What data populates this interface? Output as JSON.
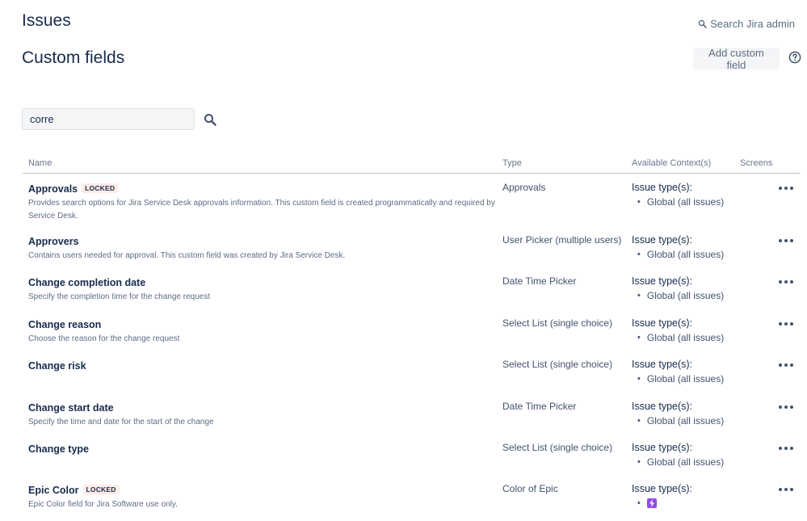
{
  "header": {
    "section_title": "Issues",
    "search_admin_label": "Search Jira admin",
    "page_title": "Custom fields",
    "add_button_label": "Add custom field"
  },
  "filter": {
    "value": "corre"
  },
  "table": {
    "columns": [
      "Name",
      "Type",
      "Available Context(s)",
      "Screens"
    ],
    "rows": [
      {
        "name": "Approvals",
        "lozenge": "LOCKED",
        "description": "Provides search options for Jira Service Desk approvals information. This custom field is created programmatically and required by Service Desk.",
        "type": "Approvals",
        "context_label": "Issue type(s):",
        "context_value": "Global (all issues)"
      },
      {
        "name": "Approvers",
        "description": "Contains users needed for approval. This custom field was created by Jira Service Desk.",
        "type": "User Picker (multiple users)",
        "context_label": "Issue type(s):",
        "context_value": "Global (all issues)"
      },
      {
        "name": "Change completion date",
        "description": "Specify the completion time for the change request",
        "type": "Date Time Picker",
        "context_label": "Issue type(s):",
        "context_value": "Global (all issues)"
      },
      {
        "name": "Change reason",
        "description": "Choose the reason for the change request",
        "type": "Select List (single choice)",
        "context_label": "Issue type(s):",
        "context_value": "Global (all issues)"
      },
      {
        "name": "Change risk",
        "description": "",
        "type": "Select List (single choice)",
        "context_label": "Issue type(s):",
        "context_value": "Global (all issues)"
      },
      {
        "name": "Change start date",
        "description": "Specify the time and date for the start of the change",
        "type": "Date Time Picker",
        "context_label": "Issue type(s):",
        "context_value": "Global (all issues)"
      },
      {
        "name": "Change type",
        "description": "",
        "type": "Select List (single choice)",
        "context_label": "Issue type(s):",
        "context_value": "Global (all issues)"
      },
      {
        "name": "Epic Color",
        "lozenge": "LOCKED",
        "description": "Epic Color field for Jira Software use only.",
        "type": "Color of Epic",
        "context_label": "Issue type(s):",
        "context_icon": "epic-icon"
      }
    ]
  },
  "colors": {
    "text": "#172b4d",
    "subtle": "#5e6c84",
    "locked_bg": "#ffebe6",
    "epic_icon": "#904ee2"
  }
}
